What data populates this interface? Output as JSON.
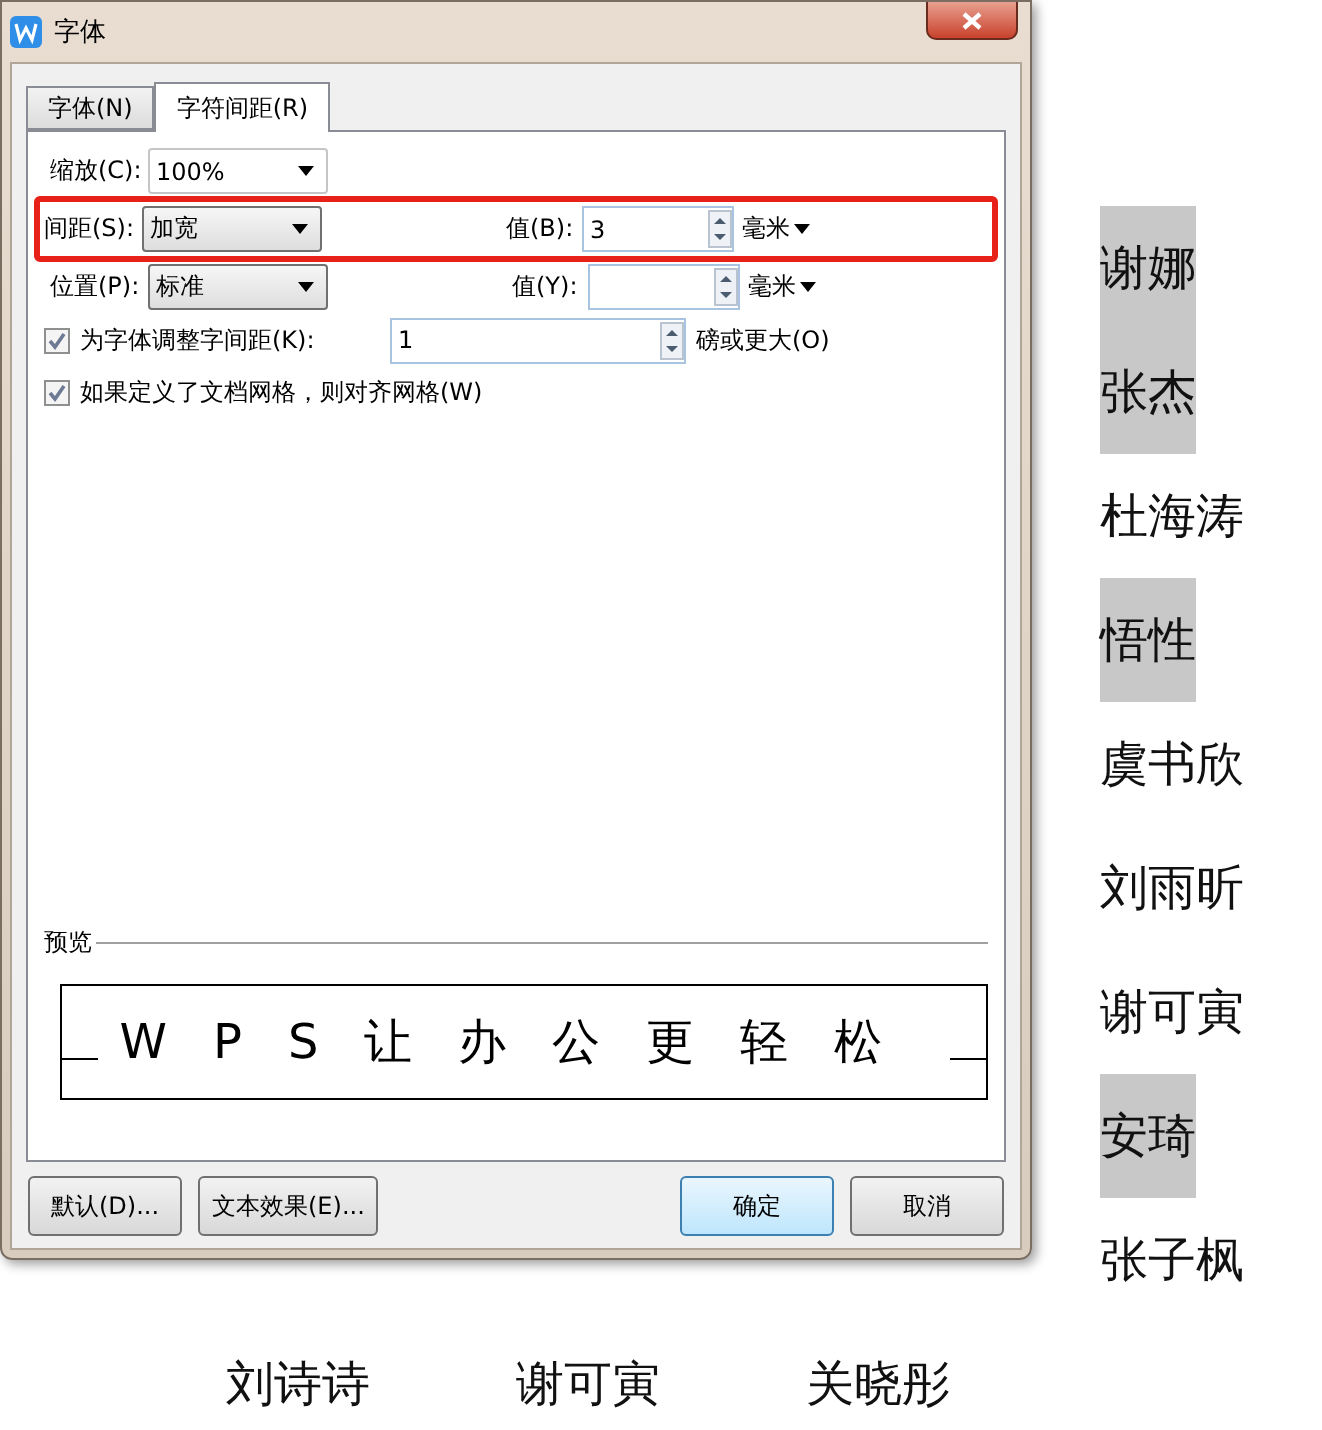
{
  "dialog": {
    "title": "字体",
    "tabs": [
      {
        "label": "字体(N)",
        "selected": false
      },
      {
        "label": "字符间距(R)",
        "selected": true
      }
    ],
    "rows": [
      {
        "label": "缩放(C):",
        "select": "100%"
      },
      {
        "label": "间距(S):",
        "select": "加宽",
        "value_label": "值(B):",
        "value": "3",
        "unit": "毫米",
        "highlighted": true
      },
      {
        "label": "位置(P):",
        "select": "标准",
        "value_label": "值(Y):",
        "value": "",
        "unit": "毫米",
        "highlighted": false
      }
    ],
    "checks": [
      {
        "label": "为字体调整字间距(K):",
        "checked": true,
        "value": "1",
        "suffix": "磅或更大(O)"
      },
      {
        "label": "如果定义了文档网格，则对齐网格(W)",
        "checked": true
      }
    ],
    "preview": {
      "label": "预览",
      "text": "WPS让办公更轻松"
    },
    "buttons": [
      {
        "label": "默认(D)...",
        "default": false
      },
      {
        "label": "文本效果(E)...",
        "default": false
      },
      {
        "label": "确定",
        "default": true
      },
      {
        "label": "取消",
        "default": false
      }
    ]
  },
  "document": {
    "column": [
      {
        "name": "谢娜",
        "highlighted": true
      },
      {
        "name": "张杰",
        "highlighted": true
      },
      {
        "name": "杜海涛",
        "highlighted": false
      },
      {
        "name": "悟性",
        "highlighted": true
      },
      {
        "name": "虞书欣",
        "highlighted": false
      },
      {
        "name": "刘雨昕",
        "highlighted": false
      },
      {
        "name": "谢可寅",
        "highlighted": false
      },
      {
        "name": "安琦",
        "highlighted": true
      },
      {
        "name": "张子枫",
        "highlighted": false
      }
    ],
    "bottom_row": [
      "刘诗诗",
      "谢可寅",
      "关晓彤"
    ]
  }
}
